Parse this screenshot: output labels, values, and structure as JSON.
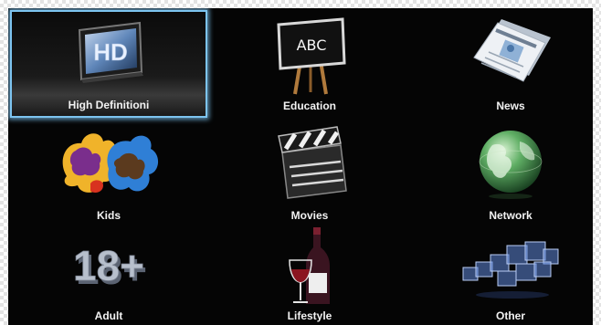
{
  "menu": {
    "items": [
      {
        "label": "High Definitioni",
        "icon": "hd-tv-icon",
        "selected": true
      },
      {
        "label": "Education",
        "icon": "chalkboard-abc-icon"
      },
      {
        "label": "News",
        "icon": "newspaper-icon"
      },
      {
        "label": "Kids",
        "icon": "hand-prints-icon"
      },
      {
        "label": "Movies",
        "icon": "clapperboard-icon"
      },
      {
        "label": "Network",
        "icon": "globe-icon"
      },
      {
        "label": "Adult",
        "icon": "eighteen-plus-icon"
      },
      {
        "label": "Lifestyle",
        "icon": "wine-bottle-glass-icon"
      },
      {
        "label": "Other",
        "icon": "cubes-icon"
      }
    ]
  },
  "icons": {
    "hd_text": "HD",
    "chalkboard_text": "ABC",
    "adult_text": "18+"
  },
  "colors": {
    "screen_background": "#050505",
    "selection_border": "#7dc4f0",
    "label_text": "#f2f2f2"
  }
}
